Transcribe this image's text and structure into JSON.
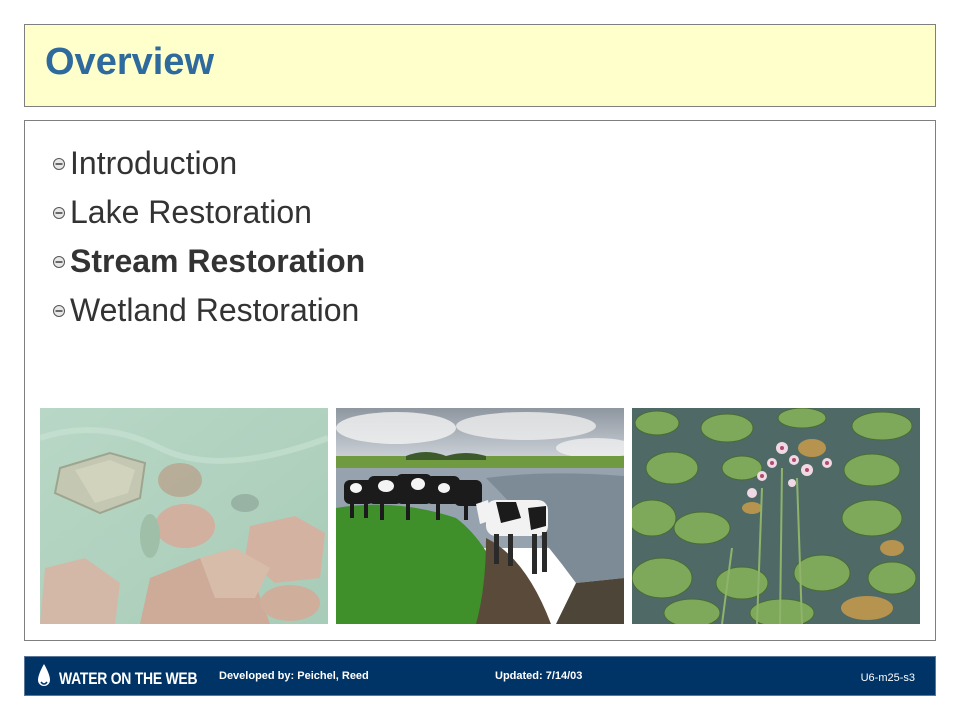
{
  "slide": {
    "title": "Overview"
  },
  "bullets": [
    {
      "label": "Introduction",
      "active": false
    },
    {
      "label": "Lake Restoration",
      "active": false
    },
    {
      "label": "Stream Restoration",
      "active": true
    },
    {
      "label": "Wetland Restoration",
      "active": false
    }
  ],
  "photos": [
    {
      "icon": "rocks-in-lake-photo"
    },
    {
      "icon": "cows-at-stream-photo"
    },
    {
      "icon": "wetland-lily-pads-photo"
    }
  ],
  "footer": {
    "logo_text": "WATER ON THE WEB",
    "developed_by": "Developed by: Peichel, Reed",
    "updated": "Updated: 7/14/03",
    "slide_id": "U6-m25-s3"
  },
  "colors": {
    "title": "#2e6a9e",
    "title_background": "#ffffcc",
    "footer_background": "#003366",
    "bullet_text": "#333333"
  }
}
